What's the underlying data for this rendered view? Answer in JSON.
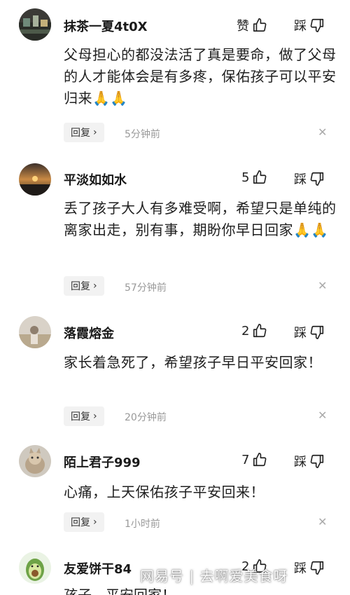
{
  "comments": [
    {
      "username": "抹茶一夏4t0X",
      "like_label": "赞",
      "dislike_label": "踩",
      "body": "父母担心的都没法活了真是要命，做了父母的人才能体会是有多疼，保佑孩子可以平安归来🙏🙏",
      "reply_label": "回复",
      "time": "5分钟前"
    },
    {
      "username": "平淡如如水",
      "like_label": "5",
      "dislike_label": "踩",
      "body": "丢了孩子大人有多难受啊，希望只是单纯的离家出走，别有事，期盼你早日回家🙏🙏",
      "reply_label": "回复",
      "time": "57分钟前"
    },
    {
      "username": "落霞熔金",
      "like_label": "2",
      "dislike_label": "踩",
      "body": "家长着急死了，希望孩子早日平安回家！",
      "reply_label": "回复",
      "time": "20分钟前"
    },
    {
      "username": "陌上君子999",
      "like_label": "7",
      "dislike_label": "踩",
      "body": "心痛，上天保佑孩子平安回来！",
      "reply_label": "回复",
      "time": "1小时前"
    },
    {
      "username": "友爱饼干84",
      "like_label": "2",
      "dislike_label": "踩",
      "body": "孩子，平安回家！"
    }
  ],
  "watermark": "网易号 | 去啊爱美食呀",
  "icons": {
    "like": "thumbs-up-icon",
    "dislike": "thumbs-down-icon",
    "close": "close-icon",
    "chevron": "chevron-right-icon"
  },
  "colors": {
    "reply_bg": "#f2f2f2",
    "time": "#999999"
  }
}
